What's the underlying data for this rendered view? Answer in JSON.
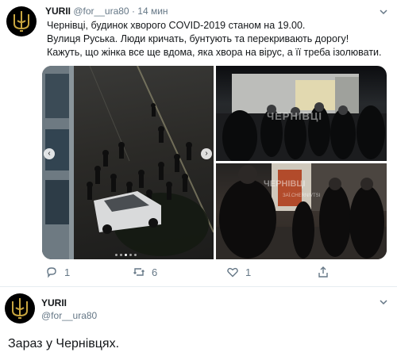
{
  "tweet1": {
    "display_name": "YURII",
    "handle": "@for__ura80",
    "separator": "·",
    "time": "14 мин",
    "lines": [
      "Чернівці, будинок хворого COVID-2019 станом на 19.00.",
      "Вулиця Руська. Люди кричать, бунтують та перекривають дорогу!",
      "Кажуть, що жінка все ще вдома, яка хвора на вірус, а її треба ізолювати."
    ],
    "media": {
      "watermark": "ЧЕРНІВЦІ",
      "watermark_small": "ЧЕРНІВЦІ",
      "watermark_sub": "ЗАЇ.CHERNIVTSI",
      "carousel_dots": 5,
      "active_dot": 2
    },
    "actions": {
      "reply_count": "1",
      "retweet_count": "6",
      "like_count": "1"
    }
  },
  "tweet2": {
    "display_name": "YURII",
    "handle": "@for__ura80",
    "text": "Зараз у Чернівцях."
  },
  "icons": {
    "avatar": "trident-emblem-icon",
    "more": "chevron-down-icon",
    "reply": "reply-icon",
    "retweet": "retweet-icon",
    "like": "heart-icon",
    "share": "share-icon"
  },
  "colors": {
    "text": "#14171a",
    "muted": "#657786",
    "divider": "#e6ecf0",
    "emblem": "#c9a640"
  }
}
